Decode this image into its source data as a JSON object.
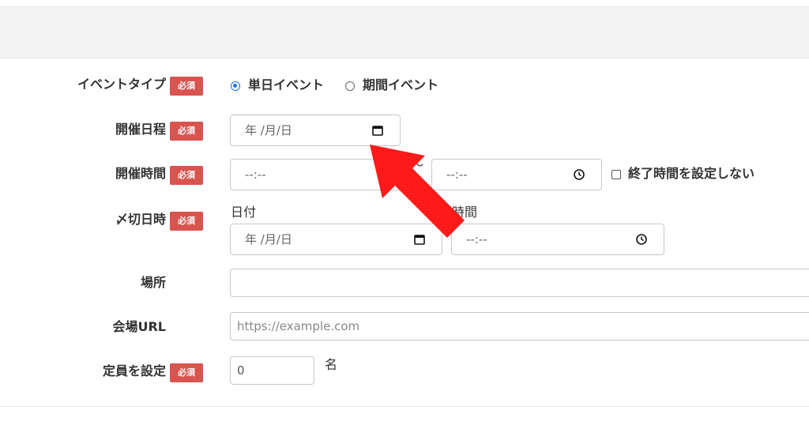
{
  "form": {
    "required_badge": "必須",
    "event_type": {
      "label": "イベントタイプ",
      "options": [
        "単日イベント",
        "期間イベント"
      ],
      "selected": "単日イベント"
    },
    "event_date": {
      "label": "開催日程",
      "placeholder": "年 /月/日"
    },
    "event_time": {
      "label": "開催時間",
      "start_placeholder": "--:--",
      "separator": "〜",
      "end_placeholder": "--:--",
      "no_end_label": "終了時間を設定しない"
    },
    "deadline": {
      "label": "〆切日時",
      "date_label": "日付",
      "date_placeholder": "年 /月/日",
      "time_label": "時間",
      "time_placeholder": "--:--"
    },
    "venue": {
      "label": "場所",
      "value": ""
    },
    "venue_url": {
      "label": "会場URL",
      "placeholder": "https://example.com"
    },
    "capacity": {
      "label": "定員を設定",
      "value": "0",
      "unit": "名"
    }
  },
  "colors": {
    "badge": "#d9534f",
    "radio_accent": "#1a73e8",
    "arrow": "#ff1a1a"
  },
  "icons": [
    "calendar-icon",
    "clock-icon",
    "red-arrow-annotation"
  ]
}
